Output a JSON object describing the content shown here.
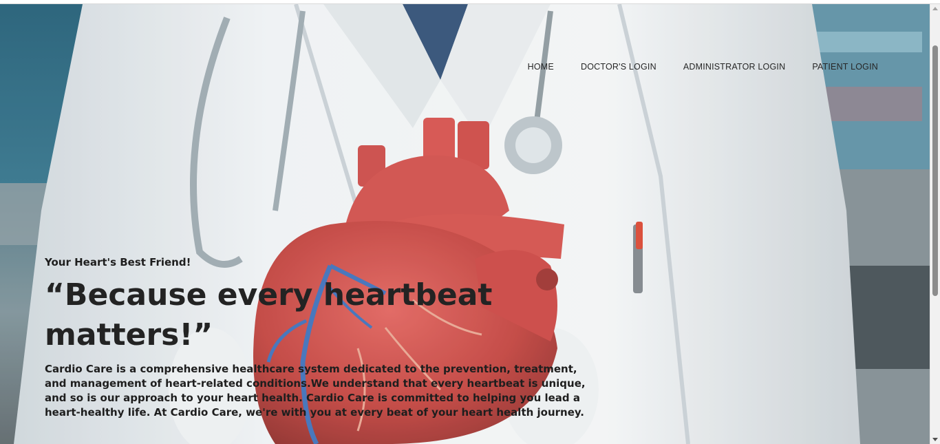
{
  "nav": {
    "items": [
      {
        "label": "HOME"
      },
      {
        "label": "DOCTOR'S LOGIN"
      },
      {
        "label": "ADMINISTRATOR LOGIN"
      },
      {
        "label": "PATIENT LOGIN"
      }
    ]
  },
  "hero": {
    "tagline": "Your Heart's Best Friend!",
    "quote": "“Because every heartbeat matters!”",
    "description": "Cardio Care is a comprehensive healthcare system dedicated to the prevention, treatment, and management of heart-related conditions.We understand that every heartbeat is unique, and so is our approach to your heart health. Cardio Care is committed to helping you lead a heart-healthy life. At Cardio Care, we're with you at every beat of your heart health journey."
  },
  "colors": {
    "text_dark": "#1e1e1e",
    "heart_red": "#c9413d",
    "coat_white": "#e9edf0"
  },
  "icons": {
    "scroll_up": "chevron-up-icon",
    "scroll_down": "chevron-down-icon"
  }
}
